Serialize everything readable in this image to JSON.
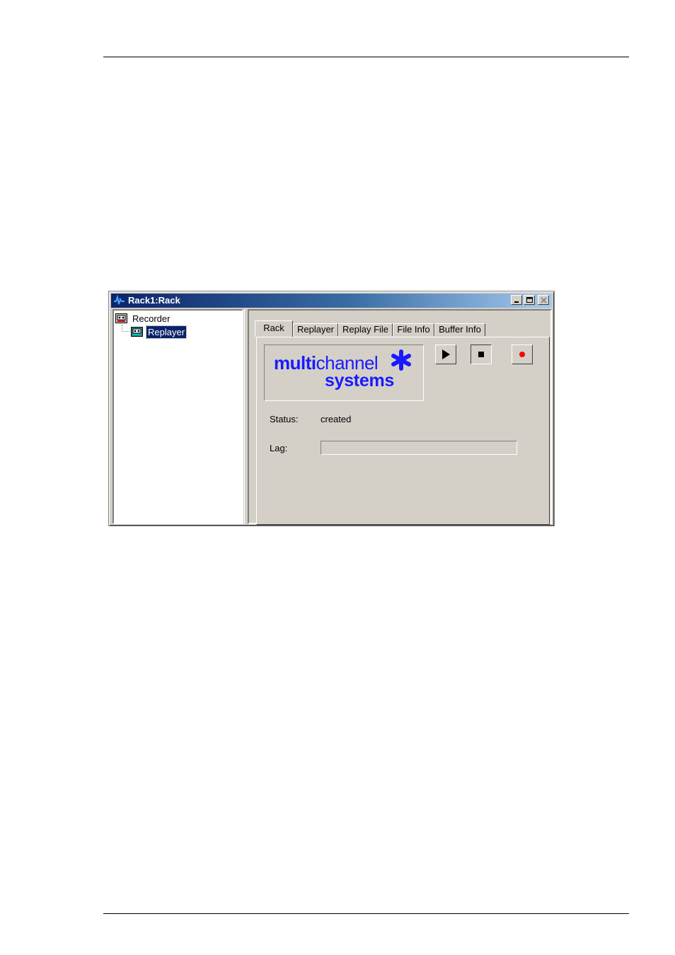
{
  "window": {
    "title": "Rack1:Rack",
    "controls": {
      "minimize": "minimize-icon",
      "maximize": "maximize-icon",
      "close": "close-icon"
    }
  },
  "tree": {
    "items": [
      {
        "label": "Recorder",
        "icon": "recorder-icon",
        "selected": false
      },
      {
        "label": "Replayer",
        "icon": "replayer-icon",
        "selected": true
      }
    ]
  },
  "tabs": [
    {
      "label": "Rack",
      "active": true
    },
    {
      "label": "Replayer",
      "active": false
    },
    {
      "label": "Replay File",
      "active": false
    },
    {
      "label": "File Info",
      "active": false
    },
    {
      "label": "Buffer Info",
      "active": false
    }
  ],
  "logo": {
    "line1_bold": "multi",
    "line1_regular": "channel",
    "line2": "systems",
    "color": "#1a1aff"
  },
  "controls": {
    "play": "play-icon",
    "stop": "stop-icon",
    "record": "record-icon",
    "record_color": "#ff0000"
  },
  "status": {
    "label": "Status:",
    "value": "created"
  },
  "lag": {
    "label": "Lag:",
    "value": 0
  },
  "colors": {
    "titlebar_start": "#0a246a",
    "titlebar_end": "#a6caf0",
    "selection": "#0a246a",
    "face": "#d4d0c8"
  }
}
